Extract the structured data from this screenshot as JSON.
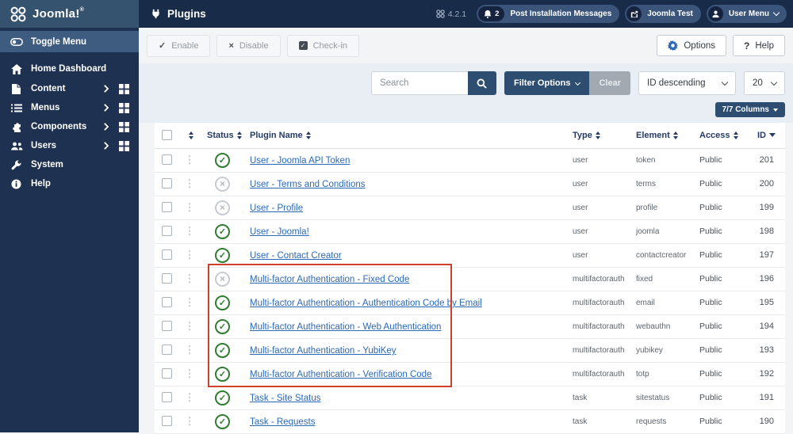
{
  "header": {
    "logo_text": "Joomla!",
    "logo_reg": "®",
    "page_title": "Plugins",
    "version": "4.2.1",
    "messages_count": "2",
    "messages_label": "Post Installation Messages",
    "site_link_label": "Joomla Test",
    "user_menu_label": "User Menu"
  },
  "sidebar": {
    "items": [
      {
        "label": "Toggle Menu",
        "icon": "toggle-icon",
        "active": true
      },
      {
        "label": "Home Dashboard",
        "icon": "home-icon"
      },
      {
        "label": "Content",
        "icon": "file-icon",
        "has_submenu": true
      },
      {
        "label": "Menus",
        "icon": "list-icon",
        "has_submenu": true
      },
      {
        "label": "Components",
        "icon": "puzzle-icon",
        "has_submenu": true
      },
      {
        "label": "Users",
        "icon": "users-icon",
        "has_submenu": true
      },
      {
        "label": "System",
        "icon": "wrench-icon"
      },
      {
        "label": "Help",
        "icon": "info-icon"
      }
    ]
  },
  "toolbar": {
    "enable_label": "Enable",
    "disable_label": "Disable",
    "checkin_label": "Check-in",
    "options_label": "Options",
    "help_label": "Help",
    "help_glyph": "?"
  },
  "filters": {
    "search_placeholder": "Search",
    "filter_options_label": "Filter Options",
    "clear_label": "Clear",
    "sort_value": "ID descending",
    "limit_value": "20",
    "columns_label": "7/7 Columns"
  },
  "table": {
    "headers": {
      "status": "Status",
      "name": "Plugin Name",
      "type": "Type",
      "element": "Element",
      "access": "Access",
      "id": "ID"
    },
    "status_glyphs": {
      "enabled": "✓",
      "disabled": "×"
    },
    "rows": [
      {
        "status": "enabled",
        "name": "User - Joomla API Token",
        "type": "user",
        "element": "token",
        "access": "Public",
        "id": "201"
      },
      {
        "status": "disabled",
        "name": "User - Terms and Conditions",
        "type": "user",
        "element": "terms",
        "access": "Public",
        "id": "200"
      },
      {
        "status": "disabled",
        "name": "User - Profile",
        "type": "user",
        "element": "profile",
        "access": "Public",
        "id": "199"
      },
      {
        "status": "enabled",
        "name": "User - Joomla!",
        "type": "user",
        "element": "joomla",
        "access": "Public",
        "id": "198"
      },
      {
        "status": "enabled",
        "name": "User - Contact Creator",
        "type": "user",
        "element": "contactcreator",
        "access": "Public",
        "id": "197"
      },
      {
        "status": "disabled",
        "name": "Multi-factor Authentication - Fixed Code",
        "type": "multifactorauth",
        "element": "fixed",
        "access": "Public",
        "id": "196",
        "highlighted": true
      },
      {
        "status": "enabled",
        "name": "Multi-factor Authentication - Authentication Code by Email",
        "type": "multifactorauth",
        "element": "email",
        "access": "Public",
        "id": "195",
        "highlighted": true
      },
      {
        "status": "enabled",
        "name": "Multi-factor Authentication - Web Authentication",
        "type": "multifactorauth",
        "element": "webauthn",
        "access": "Public",
        "id": "194",
        "highlighted": true
      },
      {
        "status": "enabled",
        "name": "Multi-factor Authentication - YubiKey",
        "type": "multifactorauth",
        "element": "yubikey",
        "access": "Public",
        "id": "193",
        "highlighted": true
      },
      {
        "status": "enabled",
        "name": "Multi-factor Authentication - Verification Code",
        "type": "multifactorauth",
        "element": "totp",
        "access": "Public",
        "id": "192",
        "highlighted": true
      },
      {
        "status": "enabled",
        "name": "Task - Site Status",
        "type": "task",
        "element": "sitestatus",
        "access": "Public",
        "id": "191"
      },
      {
        "status": "enabled",
        "name": "Task - Requests",
        "type": "task",
        "element": "requests",
        "access": "Public",
        "id": "190"
      }
    ]
  },
  "colors": {
    "header_bg": "#182b48",
    "logo_bg": "#35536f",
    "sidebar_bg": "#1e3150",
    "active_item_bg": "#3e5c80",
    "pill_bg": "#3a547a",
    "pill_inner_bg": "#16233f",
    "primary_button": "#2d4e70",
    "link": "#2a69b8",
    "status_enabled": "#2e7d32",
    "status_disabled": "#c6ccd2",
    "annotation_red": "#d2402e",
    "filter_band_bg": "#e8eef3",
    "page_bg": "#f2f4f6"
  }
}
